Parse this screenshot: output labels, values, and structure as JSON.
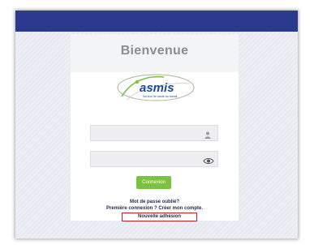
{
  "header": {
    "bar_color": "#2b3a8e"
  },
  "login": {
    "title": "Bienvenue",
    "logo": {
      "brand": "asmis",
      "tagline": "Service de santé au travail",
      "brand_color": "#1b4b9b",
      "accent_color": "#7cc242"
    },
    "username_field": {
      "value": "",
      "icon": "user-icon"
    },
    "password_field": {
      "value": "",
      "icon": "eye-icon"
    },
    "submit_label": "Connexion",
    "submit_color": "#7cc242",
    "forgot_password": "Mot de passe oublié?",
    "first_login": "Première connexion ? Créer mon compte.",
    "new_membership": "Nouvelle adhésion"
  }
}
